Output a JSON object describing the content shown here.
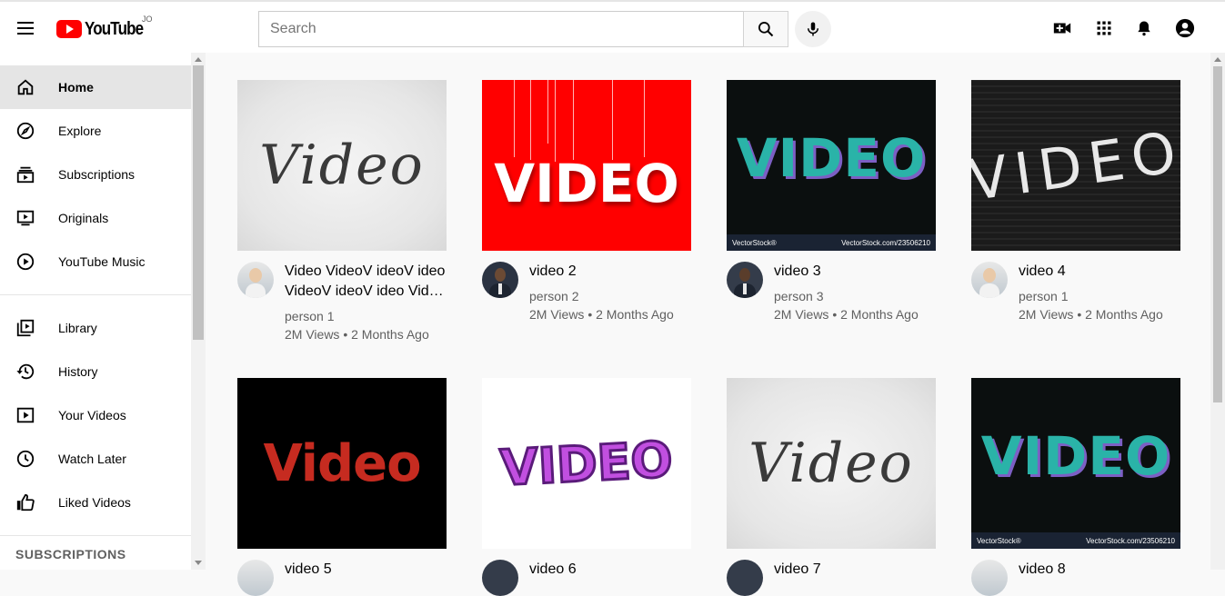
{
  "header": {
    "logo_text": "YouTube",
    "country_code": "JO",
    "search_placeholder": "Search"
  },
  "sidebar": {
    "primary": [
      {
        "label": "Home",
        "icon": "home-icon",
        "active": true
      },
      {
        "label": "Explore",
        "icon": "compass-icon"
      },
      {
        "label": "Subscriptions",
        "icon": "subscriptions-icon"
      },
      {
        "label": "Originals",
        "icon": "originals-icon"
      },
      {
        "label": "YouTube Music",
        "icon": "music-play-icon"
      }
    ],
    "secondary": [
      {
        "label": "Library",
        "icon": "library-icon"
      },
      {
        "label": "History",
        "icon": "history-icon"
      },
      {
        "label": "Your Videos",
        "icon": "your-videos-icon"
      },
      {
        "label": "Watch Later",
        "icon": "clock-icon"
      },
      {
        "label": "Liked Videos",
        "icon": "thumbs-up-icon"
      }
    ],
    "subscriptions_heading": "SUBSCRIPTIONS"
  },
  "videos": [
    {
      "title": "Video VideoV ideoV ideo VideoV ideoV ideo Vid…",
      "channel": "person 1",
      "stats": "2M Views • 2 Months Ago",
      "thumb_text": "Video",
      "thumb_style": "script-white"
    },
    {
      "title": "video 2",
      "channel": "person 2",
      "stats": "2M Views • 2 Months Ago",
      "thumb_text": "VIDEO",
      "thumb_style": "red-hanging"
    },
    {
      "title": "video 3",
      "channel": "person 3",
      "stats": "2M Views • 2 Months Ago",
      "thumb_text": "VIDEO",
      "thumb_style": "dark-colorful",
      "stock_left": "VectorStock®",
      "stock_right": "VectorStock.com/23506210"
    },
    {
      "title": "video 4",
      "channel": "person 1",
      "stats": "2M Views • 2 Months Ago",
      "thumb_text": "VIDEO",
      "thumb_style": "letterboard"
    },
    {
      "title": "video 5",
      "channel": "",
      "stats": "",
      "thumb_text": "Video",
      "thumb_style": "black-red"
    },
    {
      "title": "video 6",
      "channel": "",
      "stats": "",
      "thumb_text": "VIDEO",
      "thumb_style": "white-purple"
    },
    {
      "title": "video 7",
      "channel": "",
      "stats": "",
      "thumb_text": "Video",
      "thumb_style": "script-white"
    },
    {
      "title": "video 8",
      "channel": "",
      "stats": "",
      "thumb_text": "VIDEO",
      "thumb_style": "dark-colorful",
      "stock_left": "VectorStock®",
      "stock_right": "VectorStock.com/23506210"
    }
  ]
}
